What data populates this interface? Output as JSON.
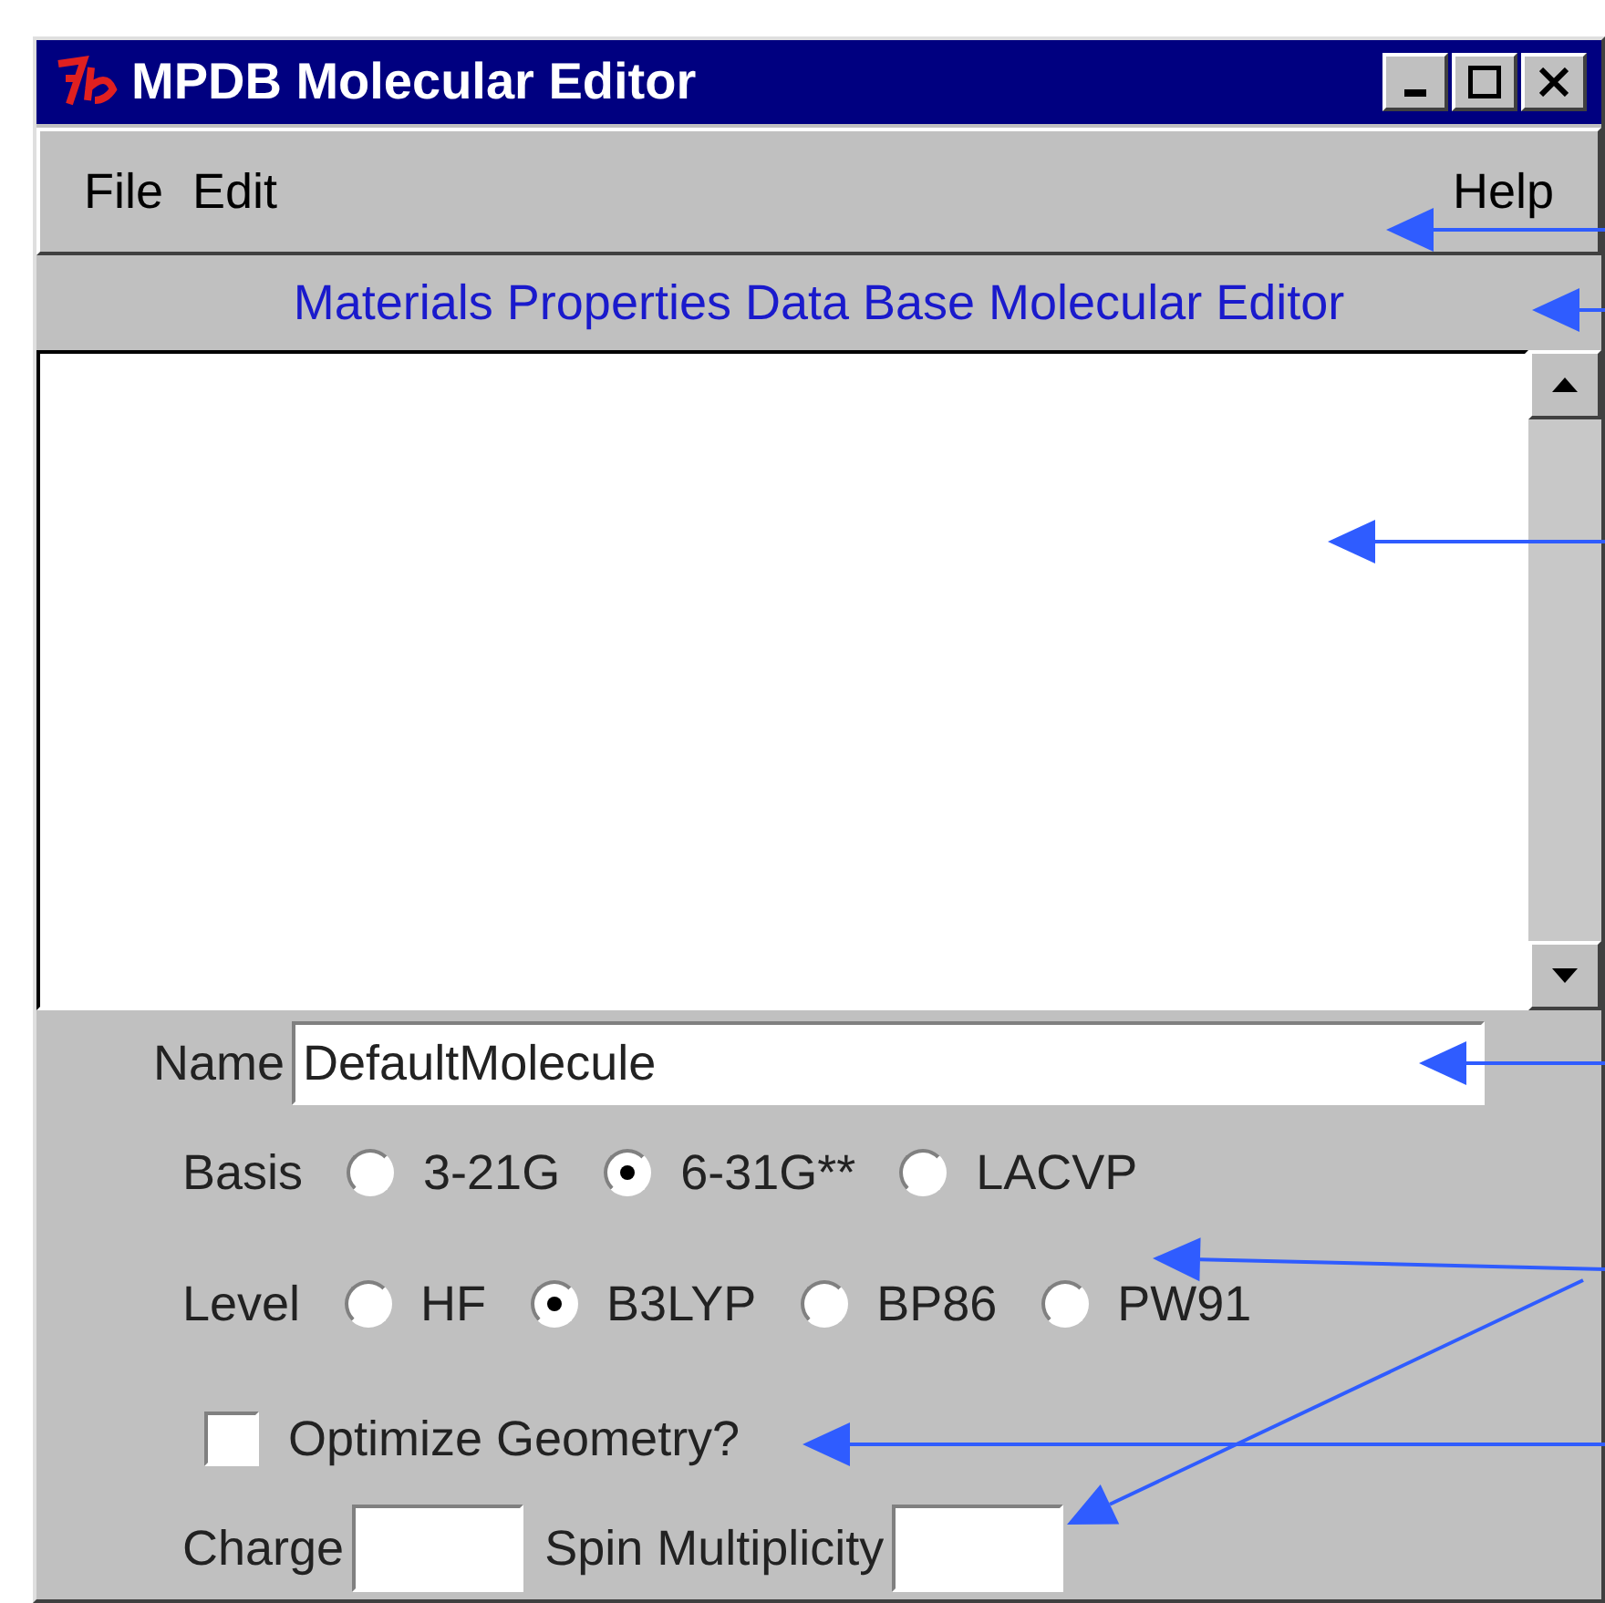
{
  "window": {
    "title": "MPDB Molecular Editor"
  },
  "menu": [
    {
      "label": "File"
    },
    {
      "label": "Edit"
    },
    {
      "label": "Help"
    }
  ],
  "subtitle": "Materials Properties Data Base Molecular Editor",
  "name_field": {
    "label": "Name",
    "value": "DefaultMolecule"
  },
  "radio_groups": [
    {
      "label": "Basis",
      "options": [
        {
          "label": "3-21G",
          "selected": false
        },
        {
          "label": "6-31G**",
          "selected": true
        },
        {
          "label": "LACVP",
          "selected": false
        }
      ]
    },
    {
      "label": "Level",
      "options": [
        {
          "label": "HF",
          "selected": false
        },
        {
          "label": "B3LYP",
          "selected": true
        },
        {
          "label": "BP86",
          "selected": false
        },
        {
          "label": "PW91",
          "selected": false
        }
      ]
    }
  ],
  "optimize": {
    "label": "Optimize Geometry?",
    "checked": false
  },
  "charge": {
    "label": "Charge"
  },
  "spin": {
    "label": "Spin Multiplicity"
  }
}
